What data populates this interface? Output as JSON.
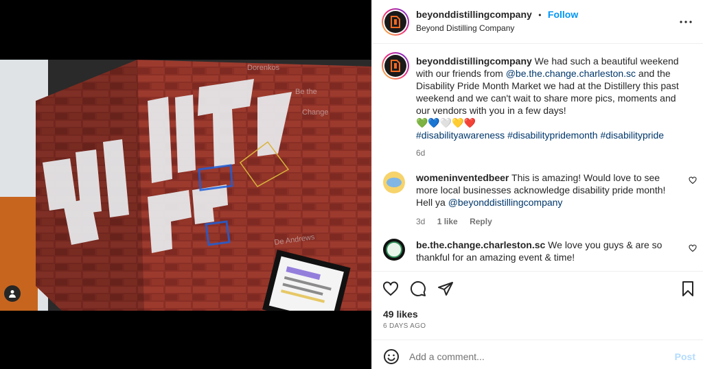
{
  "account": {
    "username": "beyonddistillingcompany",
    "follow_label": "Follow",
    "dot": "•",
    "subtitle": "Beyond Distilling Company"
  },
  "caption": {
    "username": "beyonddistillingcompany",
    "text1": " We had such a beautiful weekend with our friends from ",
    "mention": "@be.the.change.charleston.sc",
    "text2": " and the Disability Pride Month Market we had at the Distillery this past weekend and we can't wait to share more pics, moments and our vendors with you in a few days!",
    "emojis": "💚💙🤍💛❤️",
    "hashtags": "#disabilityawareness #disabilitypridemonth #disabilitypride",
    "time": "6d"
  },
  "comments": [
    {
      "username": "womeninventedbeer",
      "text": " This is amazing! Would love to see more local businesses acknowledge disability pride month! Hell ya ",
      "mention": "@beyonddistillingcompany",
      "time": "3d",
      "likes": "1 like",
      "reply": "Reply"
    },
    {
      "username": "be.the.change.charleston.sc",
      "text": " We love you guys & are so thankful for an amazing event & time!"
    }
  ],
  "stats": {
    "likes": "49 likes",
    "ago": "6 DAYS AGO"
  },
  "composer": {
    "placeholder": "Add a comment...",
    "post_label": "Post"
  },
  "icons": {
    "more": "more-horizontal-icon",
    "like": "heart-icon",
    "comment": "comment-icon",
    "share": "share-icon",
    "save": "bookmark-icon",
    "emoji": "emoji-icon",
    "tag": "user-tag-icon"
  },
  "colors": {
    "follow": "#0095f6",
    "link": "#00376b",
    "post_disabled": "#b3dbff",
    "brick": "#8a2f26"
  }
}
